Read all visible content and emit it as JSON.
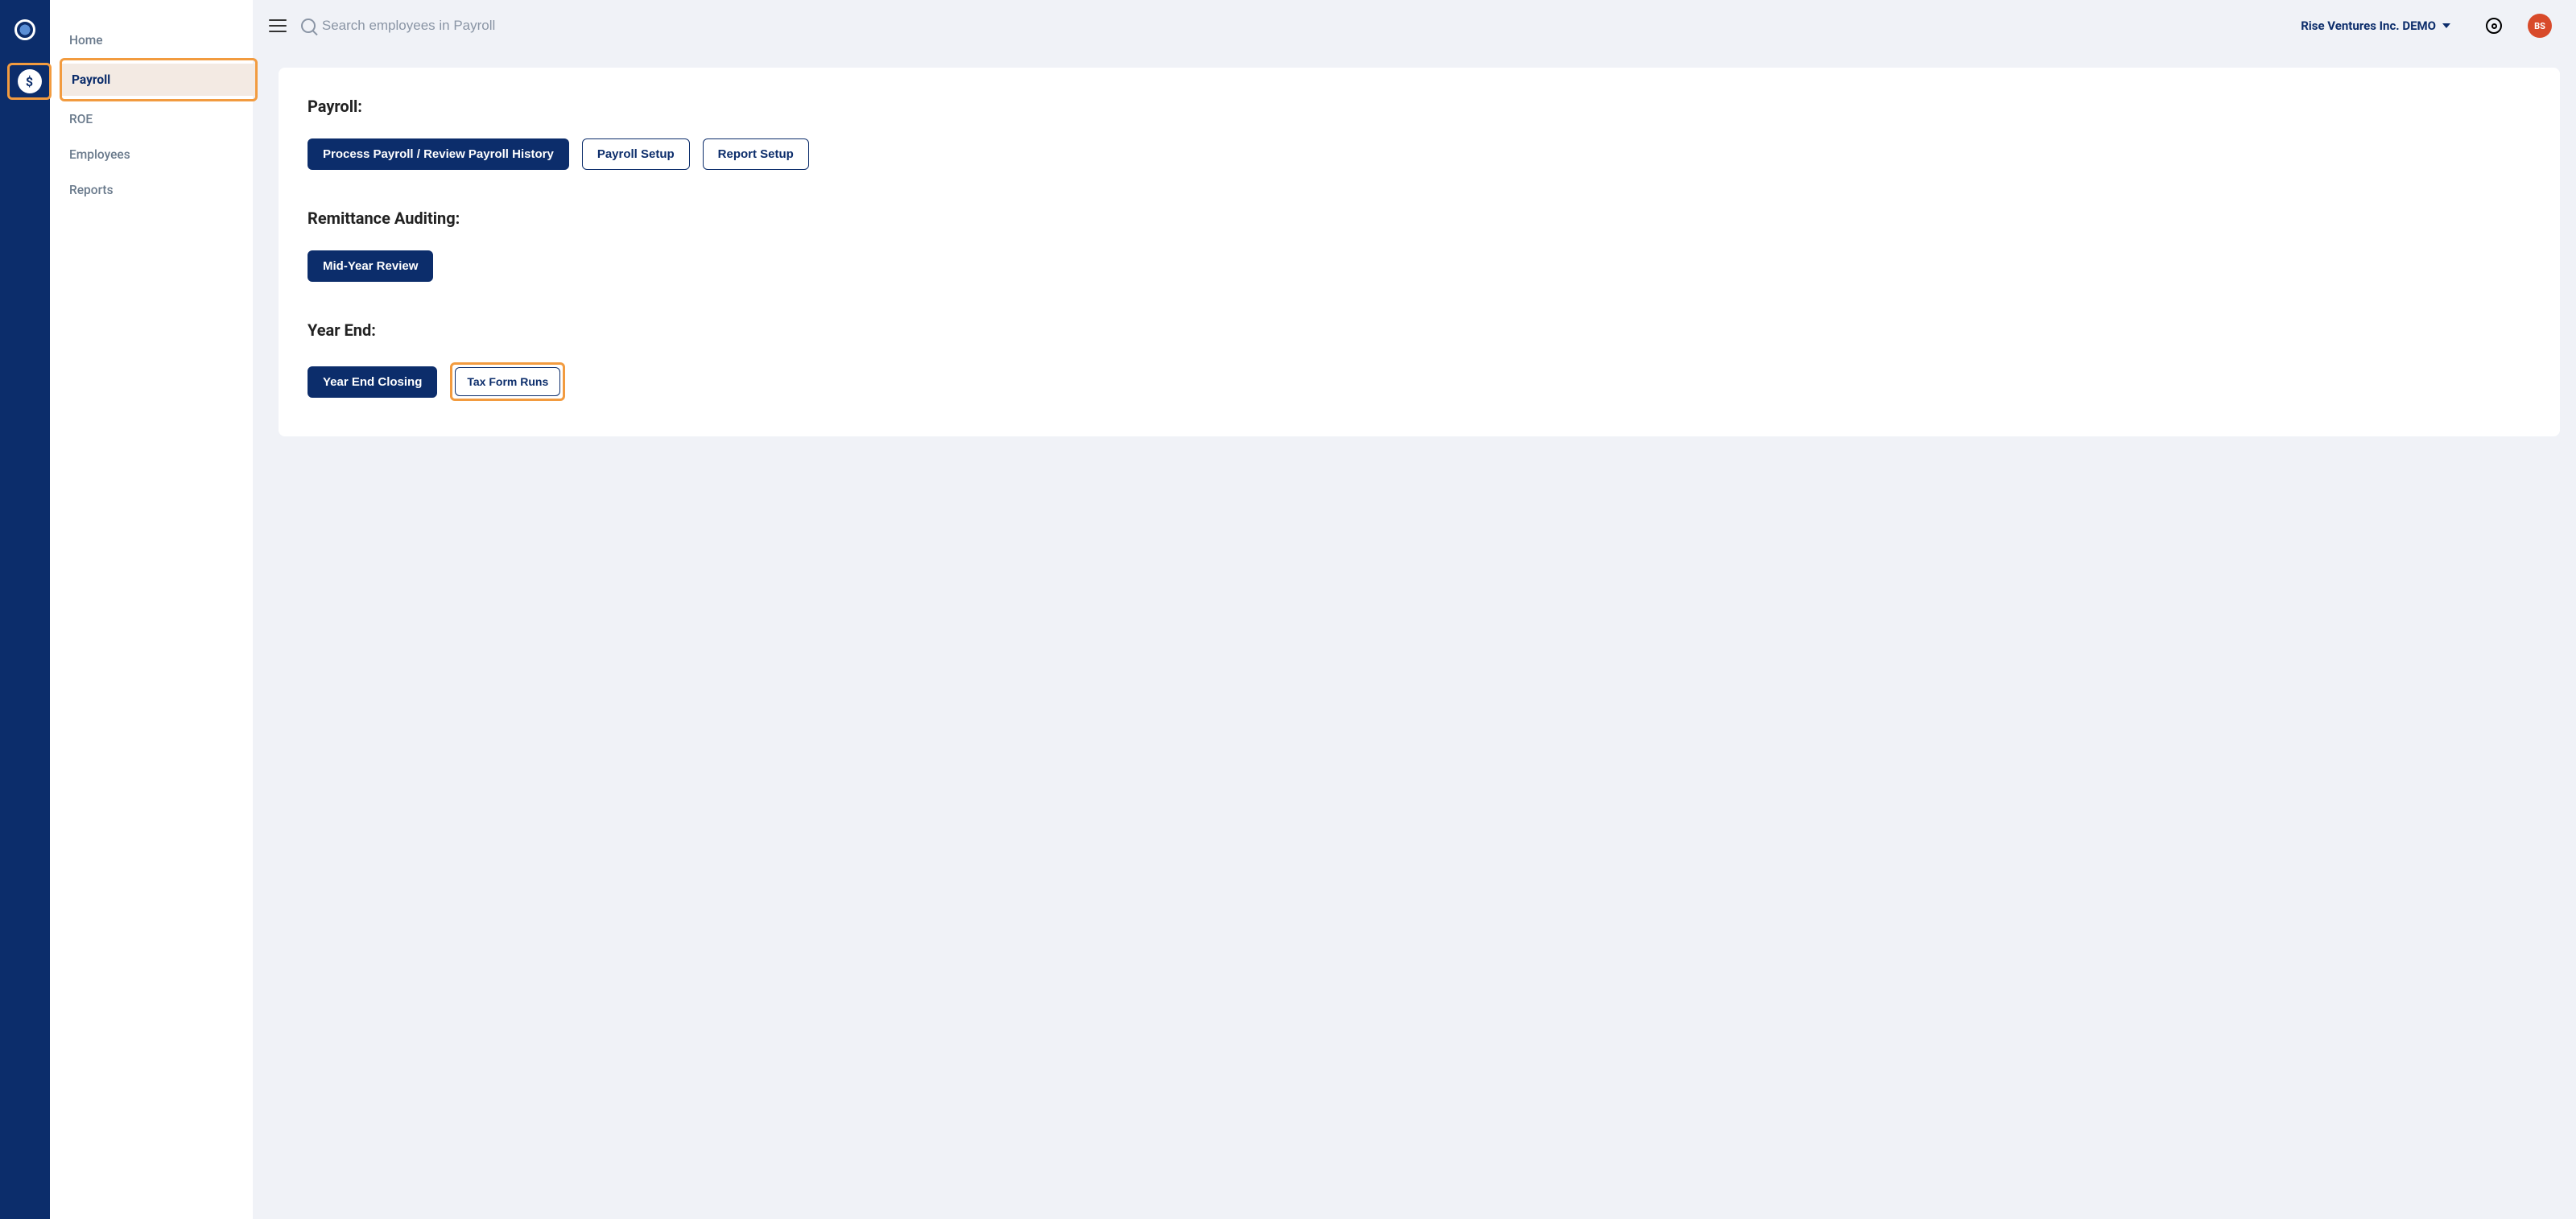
{
  "iconRail": {
    "dollarSymbol": "$"
  },
  "sidebar": {
    "items": [
      {
        "label": "Home"
      },
      {
        "label": "Payroll"
      },
      {
        "label": "ROE"
      },
      {
        "label": "Employees"
      },
      {
        "label": "Reports"
      }
    ]
  },
  "topbar": {
    "searchPlaceholder": "Search employees in Payroll",
    "orgName": "Rise Ventures Inc. DEMO",
    "avatarInitials": "BS"
  },
  "sections": {
    "payroll": {
      "title": "Payroll:",
      "buttons": {
        "process": "Process Payroll / Review Payroll History",
        "setup": "Payroll Setup",
        "reportSetup": "Report Setup"
      }
    },
    "remittance": {
      "title": "Remittance Auditing:",
      "buttons": {
        "midYear": "Mid-Year Review"
      }
    },
    "yearEnd": {
      "title": "Year End:",
      "buttons": {
        "closing": "Year End Closing",
        "taxForms": "Tax Form Runs"
      }
    }
  }
}
